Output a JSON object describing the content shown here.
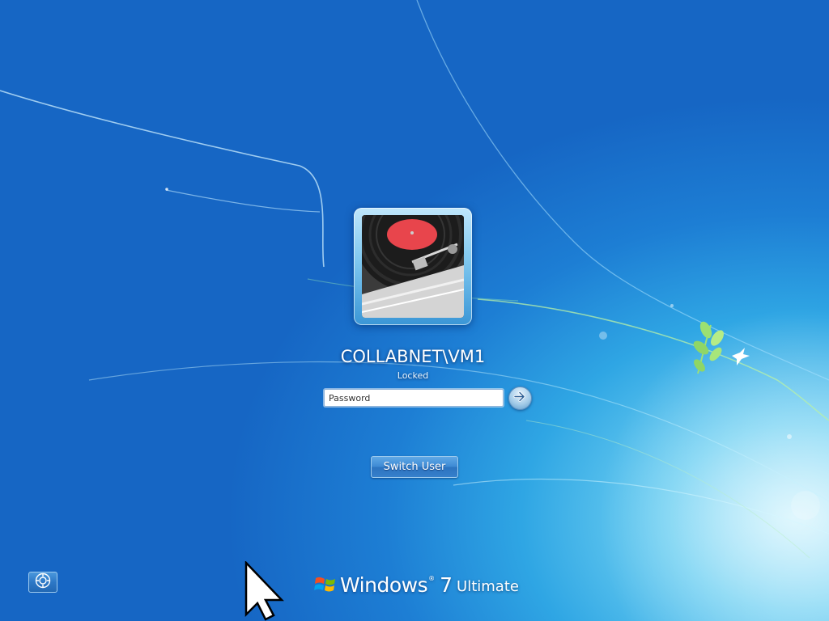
{
  "account": {
    "username": "COLLABNET\\VM1",
    "status": "Locked",
    "password_placeholder": "Password",
    "password_value": ""
  },
  "buttons": {
    "switch_user_label": "Switch User"
  },
  "branding": {
    "word": "Windows",
    "trademark": "®",
    "version": "7",
    "edition": "Ultimate"
  },
  "icons": {
    "user_tile": "turntable-record-picture",
    "submit": "arrow-right-icon",
    "ease_of_access": "ease-of-access-icon",
    "logo": "windows-flag-logo",
    "pointer": "mouse-pointer-icon"
  },
  "colors": {
    "background_deep": "#1666c4",
    "background_light": "#bfeefc",
    "record_label": "#e8454c"
  }
}
